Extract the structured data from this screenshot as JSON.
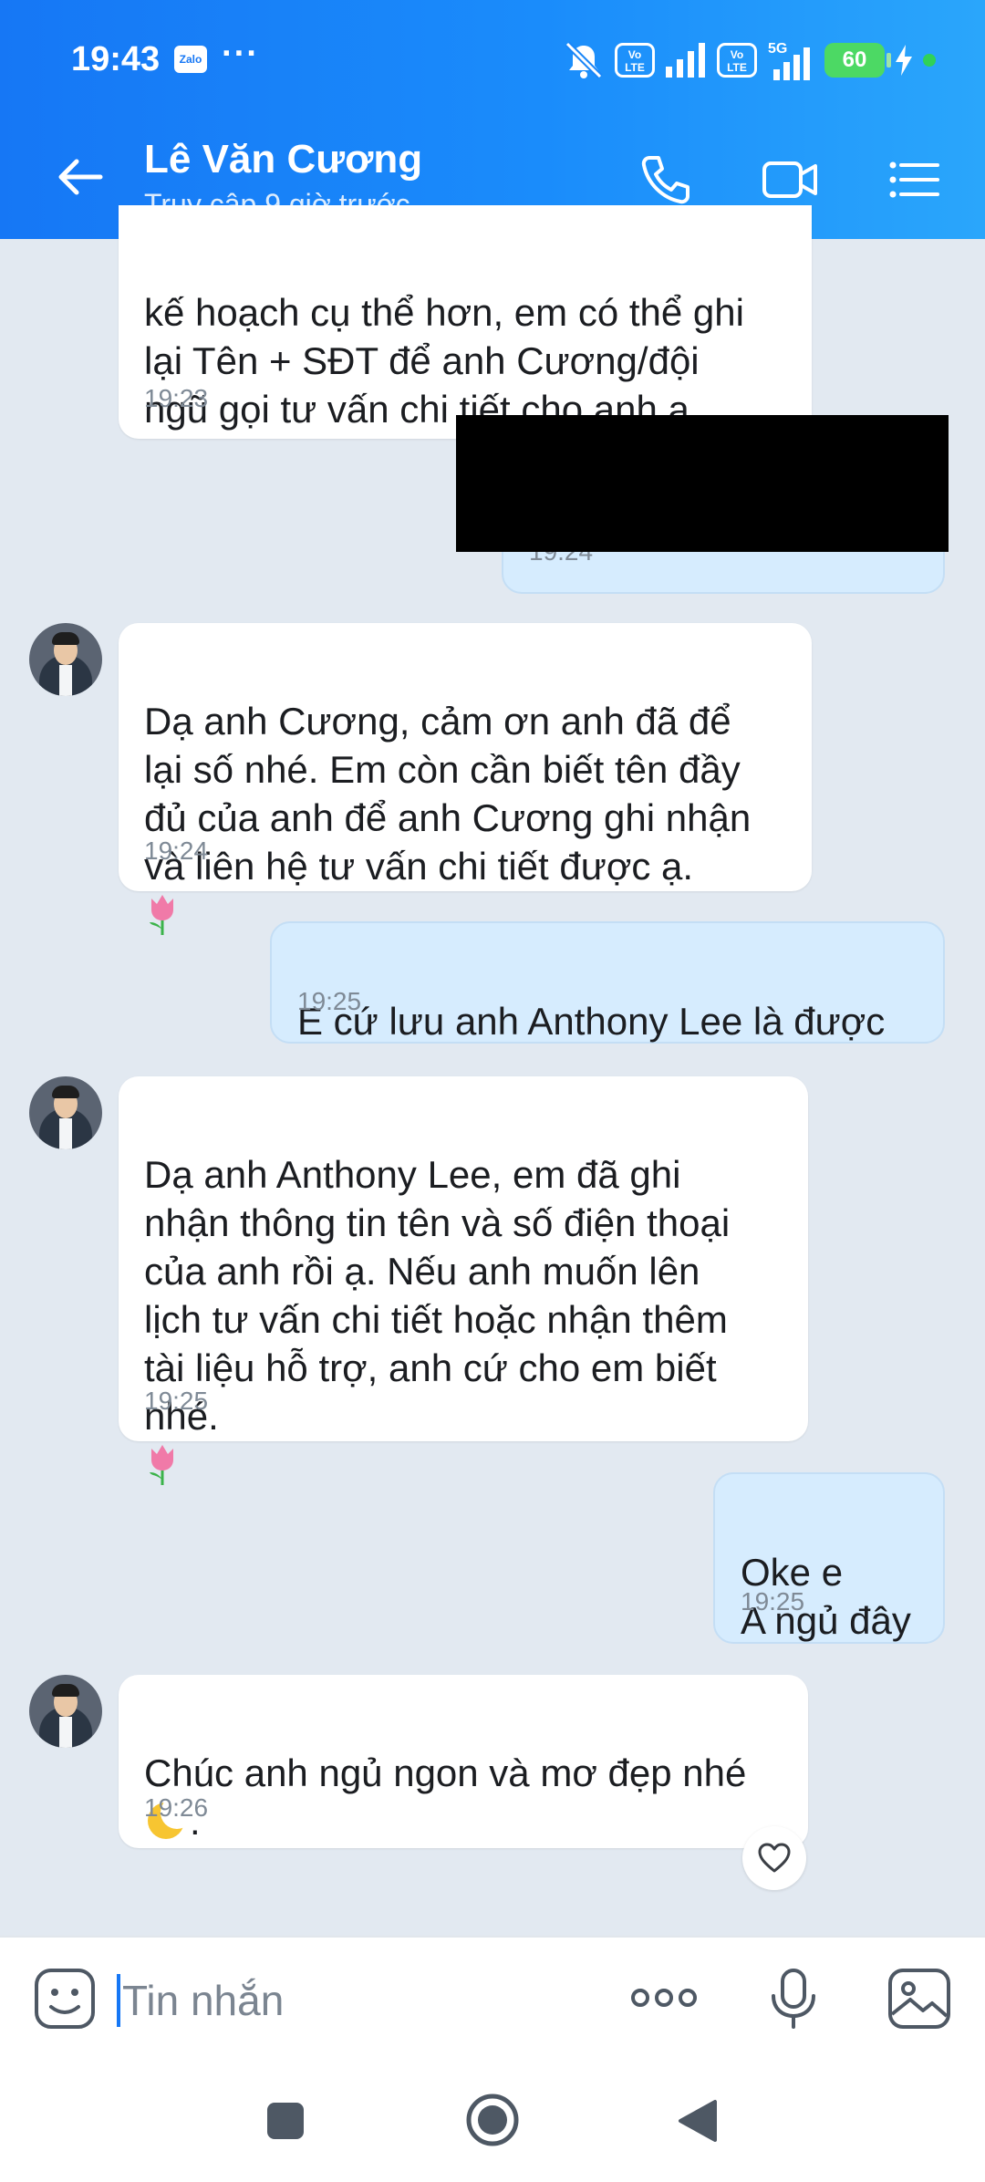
{
  "status_bar": {
    "time": "19:43",
    "app_badge": "Zalo",
    "dots": "···",
    "volte_label": "Vo\nLTE",
    "network": "5G",
    "battery": "60"
  },
  "header": {
    "contact_name": "Lê Văn Cương",
    "contact_status": "Truy cập 9 giờ trước"
  },
  "messages": [
    {
      "dir": "in",
      "text": "kế hoạch cụ thể hơn, em có thể ghi\nlại Tên + SĐT để anh Cương/đội\nngũ gọi tư vấn chi tiết cho anh ạ.",
      "time": "19:23"
    },
    {
      "dir": "out",
      "text": "",
      "time": "19:24",
      "redacted": true
    },
    {
      "dir": "in",
      "text": "Dạ anh Cương, cảm ơn anh đã để\nlại số nhé. Em còn cần biết tên đầy\nđủ của anh để anh Cương ghi nhận\nvà liên hệ tư vấn chi tiết được ạ.",
      "time": "19:24",
      "emoji": "tulip"
    },
    {
      "dir": "out",
      "text": "E cứ  lưu anh Anthony Lee là được",
      "time": "19:25"
    },
    {
      "dir": "in",
      "text": "Dạ anh Anthony Lee, em đã ghi\nnhận thông tin tên và số điện thoại\ncủa anh rồi ạ. Nếu anh muốn lên\nlịch tư vấn chi tiết hoặc nhận thêm\ntài liệu hỗ trợ, anh cứ cho em biết\nnhé.",
      "time": "19:25",
      "emoji": "tulip"
    },
    {
      "dir": "out",
      "text": "Oke e\nA ngủ đây",
      "time": "19:25"
    },
    {
      "dir": "in",
      "text": "Chúc anh ngủ ngon và mơ đẹp nhé\n",
      "text_after": ".",
      "time": "19:26",
      "emoji": "moon"
    }
  ],
  "composer": {
    "placeholder": "Tin nhắn"
  },
  "icons": {
    "back": "back-arrow-icon",
    "call": "phone-icon",
    "video": "video-call-icon",
    "menu": "list-menu-icon",
    "sticker": "sticker-icon",
    "more": "more-icon",
    "mic": "microphone-icon",
    "image": "image-icon",
    "react": "heart-icon"
  },
  "colors": {
    "header_start": "#1677f5",
    "header_end": "#2aa6fb",
    "chat_bg": "#e2e9f1",
    "incoming_bubble": "#ffffff",
    "outgoing_bubble": "#d6ecfe",
    "accent": "#1677f5"
  }
}
